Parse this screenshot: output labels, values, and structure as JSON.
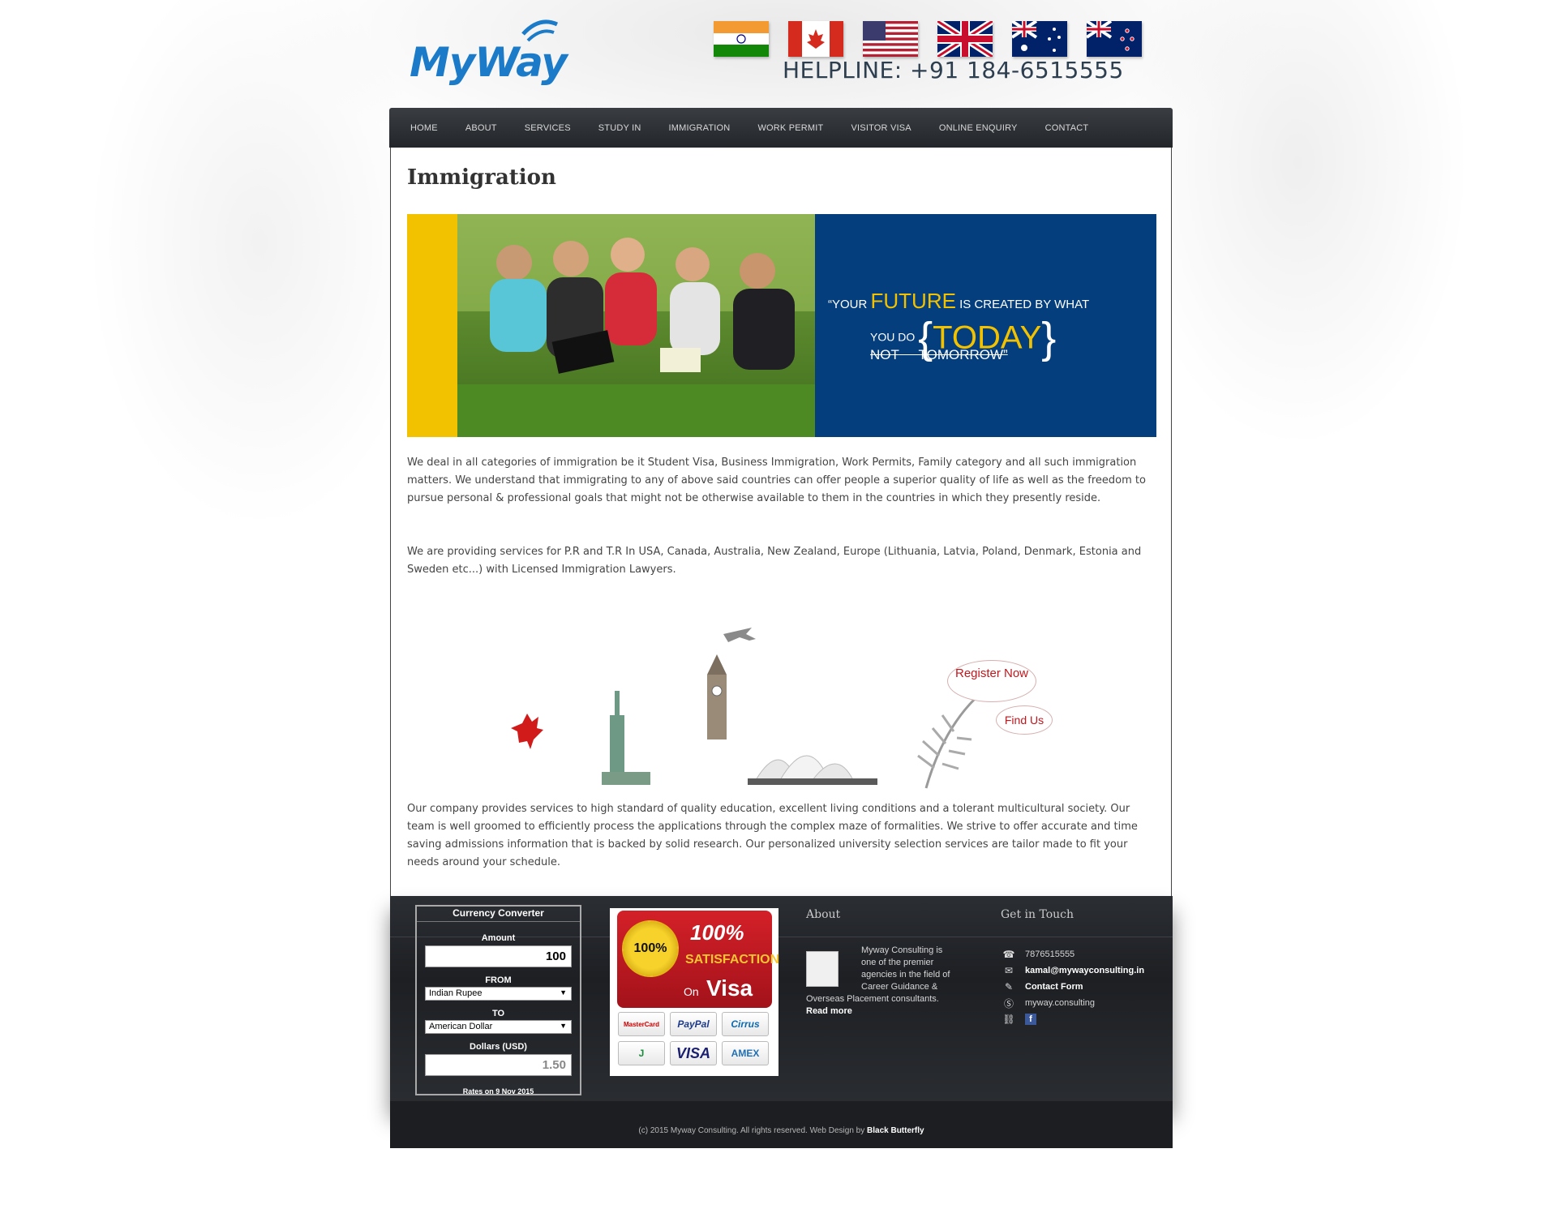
{
  "brand": {
    "name": "MyWay",
    "color": "#1b7bc9"
  },
  "header": {
    "flags": [
      "India",
      "Canada",
      "USA",
      "United Kingdom",
      "Australia",
      "New Zealand"
    ],
    "helpline": "HELPLINE: +91 184-6515555"
  },
  "nav": {
    "items": [
      "HOME",
      "ABOUT",
      "SERVICES",
      "STUDY IN",
      "IMMIGRATION",
      "WORK PERMIT",
      "VISITOR VISA",
      "ONLINE ENQUIRY",
      "CONTACT"
    ]
  },
  "main": {
    "title": "Immigration",
    "banner": {
      "quote_open": "“YOUR",
      "quote_future": "FUTURE",
      "quote_mid": "IS CREATED BY WHAT",
      "quote_youdo": "YOU DO",
      "quote_today": "TODAY",
      "quote_not": "NOT",
      "quote_tomorrow": "TOMORROW”"
    },
    "paragraph1": "We deal in all categories of immigration be it Student Visa, Business Immigration, Work Permits, Family category and all such immigration matters. We understand that immigrating to any of above said countries can offer people a superior quality of life as well as the freedom to pursue personal & professional goals that might not be otherwise available to them in the countries in which they presently reside.",
    "paragraph2": "We are providing services for P.R and T.R In USA, Canada, Australia, New Zealand, Europe (Lithuania, Latvia, Poland, Denmark, Estonia and Sweden etc...) with Licensed Immigration Lawyers.",
    "register_label": "Register Now",
    "findus_label": "Find Us",
    "paragraph3": "Our company provides services to high standard of quality education, excellent living conditions and a tolerant multicultural society. Our team is well groomed to efficiently process the applications through the complex maze of formalities. We strive to offer accurate and time saving admissions information that is backed by solid research. Our personalized university selection services are tailor made to fit your needs around your schedule."
  },
  "footer": {
    "converter": {
      "title": "Currency Converter",
      "amount_label": "Amount",
      "amount_value": "100",
      "from_label": "FROM",
      "from_value": "Indian Rupee",
      "to_label": "TO",
      "to_value": "American Dollar",
      "result_label": "Dollars (USD)",
      "result_value": "1.50",
      "rates_prefix": "Rates on",
      "rates_date": "9 Nov 2015"
    },
    "badge": {
      "seal_text": "100%",
      "big_text": "100%",
      "satisfaction": "SATISFACTION",
      "on": "On",
      "visa": "Visa",
      "cards": [
        "MasterCard",
        "PayPal",
        "Cirrus",
        "J",
        "VISA",
        "AMEX"
      ]
    },
    "about": {
      "heading": "About",
      "text_line1": "Myway Consulting is",
      "text_line2": "one of the premier",
      "text_line3": "agencies in the field of",
      "text_line4": "Career Guidance &",
      "text_line5": "Overseas Placement consultants.",
      "read_more": "Read more"
    },
    "touch": {
      "heading": "Get in Touch",
      "phone": "7876515555",
      "email": "kamal@mywayconsulting.in",
      "contact_form": "Contact Form",
      "skype": "myway.consulting",
      "facebook": "f"
    },
    "copyright": "(c) 2015 Myway Consulting. All rights reserved. Web Design by",
    "designer": "Black Butterfly"
  }
}
